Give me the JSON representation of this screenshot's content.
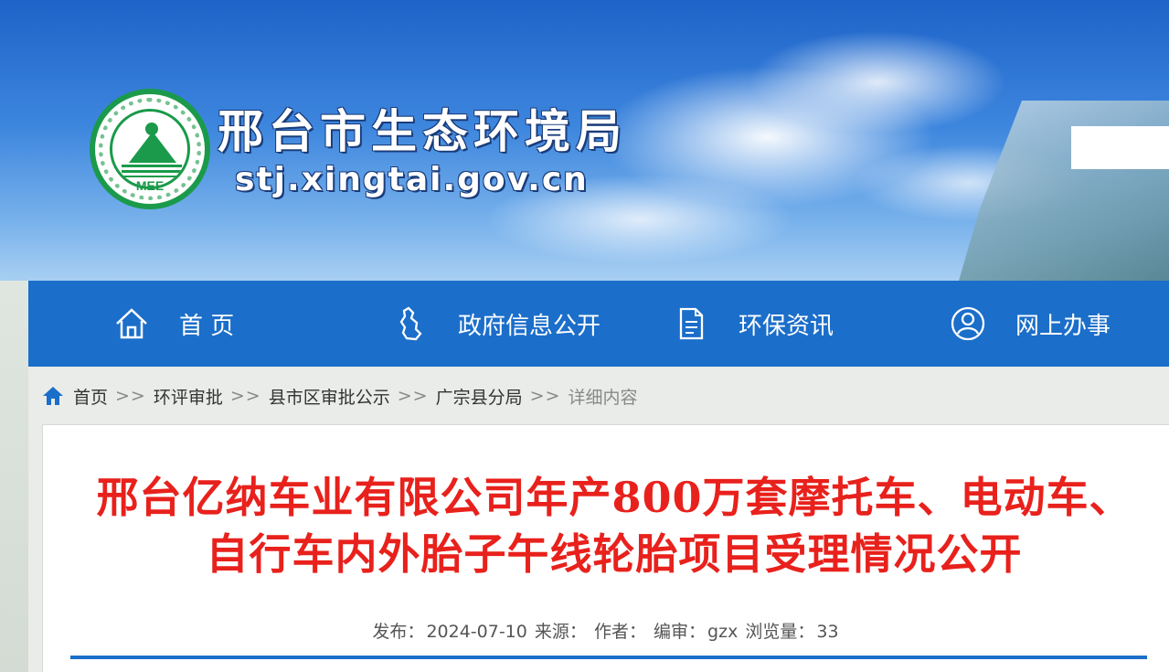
{
  "site": {
    "title": "邢台市生态环境局",
    "domain": "stj.xingtai.gov.cn",
    "logo_text": "MEE",
    "logo_icon": "mee-emblem-icon"
  },
  "nav": {
    "items": [
      {
        "label": "首 页",
        "icon": "home-icon"
      },
      {
        "label": "政府信息公开",
        "icon": "province-map-icon"
      },
      {
        "label": "环保资讯",
        "icon": "document-icon"
      },
      {
        "label": "网上办事",
        "icon": "user-icon"
      }
    ]
  },
  "breadcrumb": {
    "items": [
      "首页",
      "环评审批",
      "县市区审批公示",
      "广宗县分局"
    ],
    "separator": ">>",
    "current": "详细内容"
  },
  "article": {
    "title": "邢台亿纳车业有限公司年产800万套摩托车、电动车、自行车内外胎子午线轮胎项目受理情况公开",
    "meta": {
      "publish_label": "发布：",
      "publish_date": "2024-07-10",
      "source_label": "来源：",
      "author_label": "作者：",
      "editor_label": "编审：",
      "editor": "gzx",
      "views_label": "浏览量：",
      "views": "33"
    }
  },
  "colors": {
    "nav_bg": "#1b6ec9",
    "title_red": "#e8211c",
    "logo_green": "#1a9a4a"
  }
}
